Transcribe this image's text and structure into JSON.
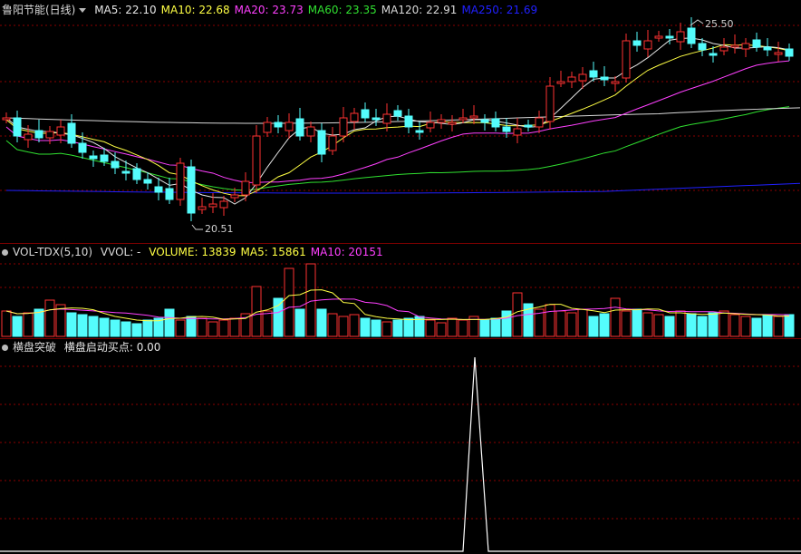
{
  "price_panel": {
    "stock_name": "鲁阳节能(日线)",
    "ma_labels": [
      {
        "text": "MA5: 22.10",
        "color": "#e6e6e6"
      },
      {
        "text": "MA10: 22.68",
        "color": "#ffff44"
      },
      {
        "text": "MA20: 23.73",
        "color": "#ff40ff"
      },
      {
        "text": "MA60: 23.35",
        "color": "#30e030"
      },
      {
        "text": "MA120: 22.91",
        "color": "#d8d8d8"
      },
      {
        "text": "MA250: 21.69",
        "color": "#2020ff"
      }
    ],
    "high_annotation": "25.50",
    "low_annotation": "20.51"
  },
  "volume_panel": {
    "title": "VOL-TDX(5,10)",
    "vwol_label": "VVOL: -",
    "labels": [
      {
        "text": "VOLUME: 13839",
        "color": "#ffff44"
      },
      {
        "text": "MA5: 15861",
        "color": "#ffff44"
      },
      {
        "text": "MA10: 20151",
        "color": "#ff40ff"
      }
    ]
  },
  "indicator_panel": {
    "title": "横盘突破",
    "signal_label": "横盘启动买点: 0.00"
  },
  "colors": {
    "up": "#ff3232",
    "down": "#54fcfc",
    "grid": "#8b0000",
    "ma5": "#e6e6e6",
    "ma10": "#ffff44",
    "ma20": "#ff40ff",
    "ma60": "#30e030",
    "ma120": "#d8d8d8",
    "ma250": "#2020ff"
  },
  "icons": [
    "arrow-down-icon",
    "circle-icon"
  ]
}
